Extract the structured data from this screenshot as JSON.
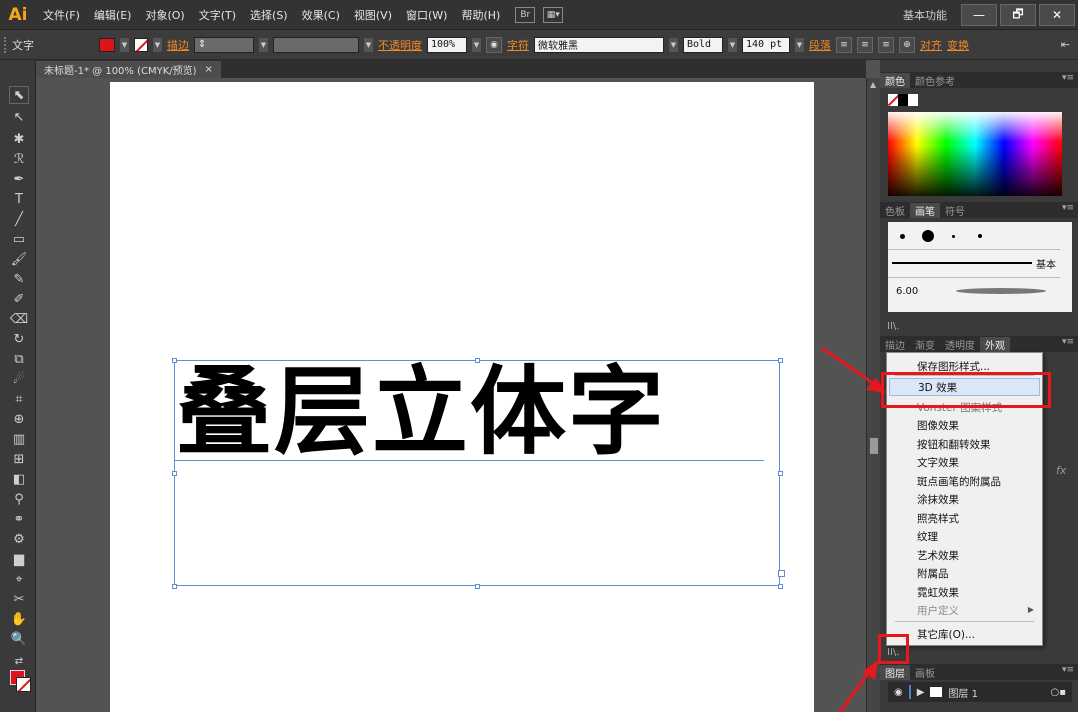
{
  "menubar": {
    "logo": "Ai",
    "items": [
      "文件(F)",
      "编辑(E)",
      "对象(O)",
      "文字(T)",
      "选择(S)",
      "效果(C)",
      "视图(V)",
      "窗口(W)",
      "帮助(H)"
    ],
    "workspace": "基本功能",
    "window_buttons": [
      "—",
      "🗗",
      "✕"
    ]
  },
  "controlbar": {
    "mode_label": "文字",
    "stroke_label": "描边",
    "opacity_label": "不透明度",
    "opacity_value": "100%",
    "char_label": "字符",
    "font_name": "微软雅黑",
    "font_style": "Bold",
    "font_size": "140 pt",
    "para_label": "段落",
    "align_label": "对齐",
    "transform_label": "变换"
  },
  "tab": {
    "title": "未标题-1* @ 100% (CMYK/预览)",
    "close": "×"
  },
  "canvas": {
    "headline": "叠层立体字"
  },
  "panels": {
    "color_tabs": [
      "颜色",
      "颜色参考"
    ],
    "brush_tabs": [
      "色板",
      "画笔",
      "符号"
    ],
    "brush_basic_label": "基本",
    "brush_size": "6.00",
    "appearance_tabs": [
      "描边",
      "渐变",
      "透明度",
      "外观"
    ],
    "layers_tabs": [
      "图层",
      "画板"
    ],
    "layer_name": "图层 1",
    "fx_label": "fx"
  },
  "dropdown": {
    "items": [
      {
        "label": "保存图形样式..."
      },
      {
        "label": "3D 效果"
      },
      {
        "label": "Vonster 图案样式"
      },
      {
        "label": "图像效果"
      },
      {
        "label": "按钮和翻转效果"
      },
      {
        "label": "文字效果"
      },
      {
        "label": "斑点画笔的附属品"
      },
      {
        "label": "涂抹效果"
      },
      {
        "label": "照亮样式"
      },
      {
        "label": "纹理"
      },
      {
        "label": "艺术效果"
      },
      {
        "label": "附属品"
      },
      {
        "label": "霓虹效果"
      },
      {
        "label": "用户定义"
      },
      {
        "label": "其它库(O)..."
      }
    ]
  },
  "colors": {
    "accent_red": "#e8171e",
    "selection_blue": "#5c8fd6",
    "menu_highlight": "#dbe7f7"
  }
}
